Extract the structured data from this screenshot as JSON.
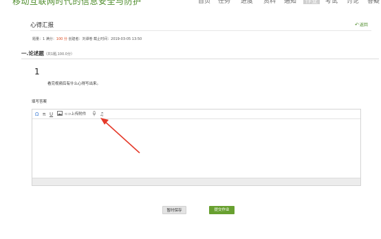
{
  "header": {
    "course_title": "移动互联网时代的信息安全与防护",
    "nav": [
      {
        "label": "首页",
        "active": false
      },
      {
        "label": "任务",
        "active": false
      },
      {
        "label": "进度",
        "active": false
      },
      {
        "label": "资料",
        "active": false
      },
      {
        "label": "通知",
        "active": false
      },
      {
        "label": "作业",
        "active": true
      },
      {
        "label": "考试",
        "active": false
      },
      {
        "label": "讨论",
        "active": false
      },
      {
        "label": "答疑",
        "active": false
      }
    ]
  },
  "page": {
    "heading": "心得汇报",
    "back_label": "返回",
    "meta": {
      "question_count": "题量：1",
      "full_score_label": "满分：",
      "full_score_value": "100 分",
      "creator": "创建者：刘谭卷",
      "deadline": "截止时间：2019-03-05 13:50"
    }
  },
  "section": {
    "title": "一.论述题",
    "subtitle": "（共1题,100.0分）"
  },
  "question": {
    "number": "1",
    "text": "看完视频后有什么心得写出来。"
  },
  "answer": {
    "label": "填写答案",
    "toolbar": {
      "omega": "Ω",
      "pi": "π",
      "underline": "U",
      "upload": "上传附件",
      "mic": "🎙",
      "music": "♫"
    }
  },
  "actions": {
    "save_label": "暂时保存",
    "submit_label": "提交作业"
  },
  "colors": {
    "accent_green": "#68a030",
    "brand_green": "#4f8d2c",
    "score_red": "#d9461a",
    "annotation_red": "#e53a2a"
  }
}
